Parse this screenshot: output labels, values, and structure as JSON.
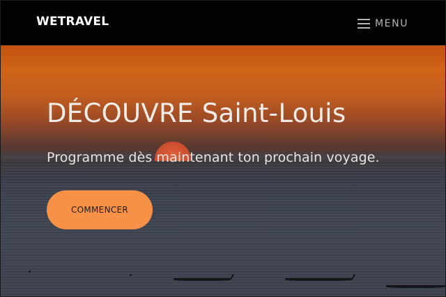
{
  "navbar": {
    "brand": "WETRAVEL",
    "menu_label": "MENU"
  },
  "hero": {
    "title": "DÉCOUVRE Saint-Louis",
    "subtitle": "Programme dès maintenant ton prochain voyage.",
    "cta_label": "COMMENCER"
  },
  "colors": {
    "navbar_bg": "#020202",
    "cta_bg": "#f79148",
    "sky_orange": "#cf6418",
    "sea_grey": "#454b58"
  },
  "icons": {
    "menu": "hamburger-icon"
  }
}
